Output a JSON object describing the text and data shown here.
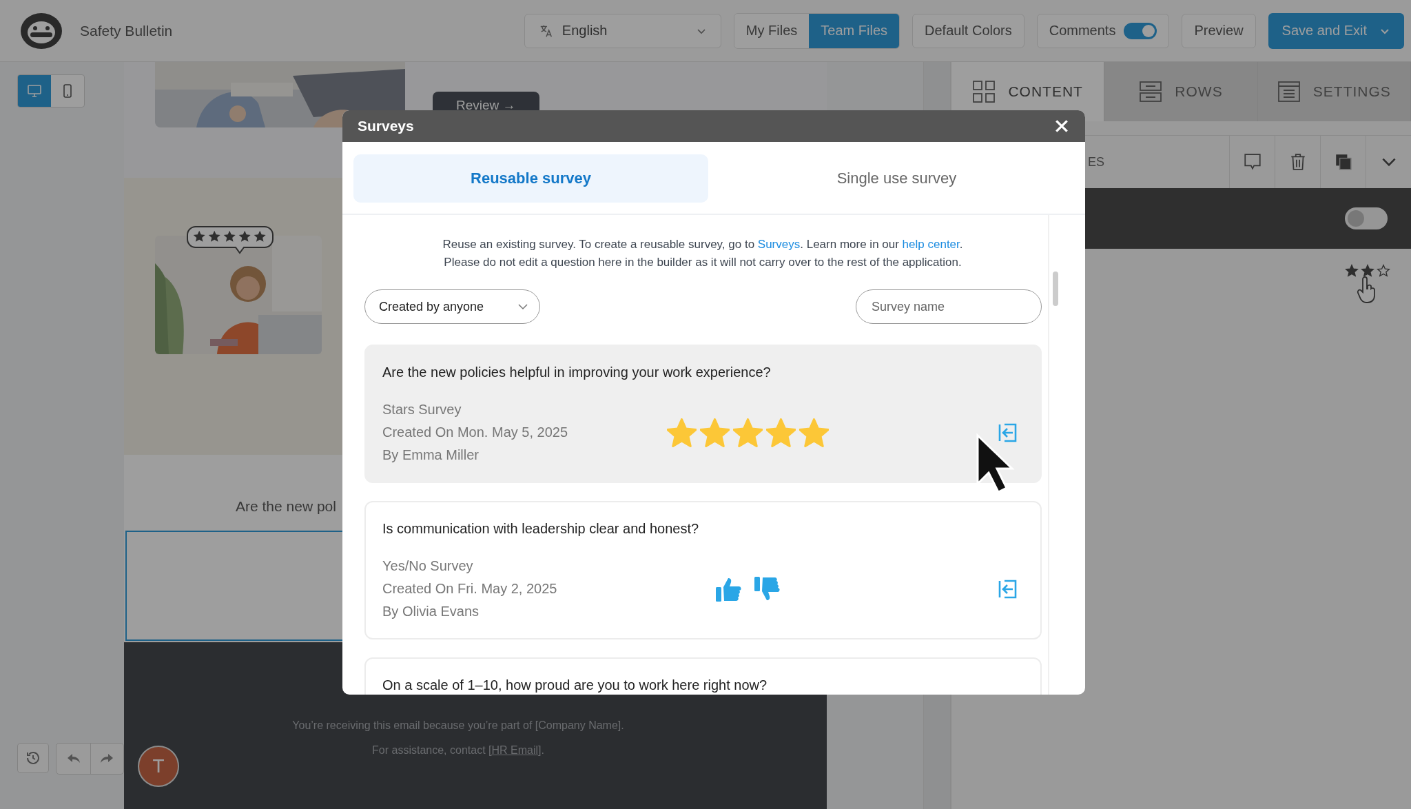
{
  "app": {
    "title": "Safety Bulletin"
  },
  "toolbar": {
    "language": "English",
    "file_tabs": [
      {
        "label": "My Files",
        "selected": false
      },
      {
        "label": "Team Files",
        "selected": true
      }
    ],
    "default_colors": "Default Colors",
    "comments": {
      "label": "Comments",
      "on": true
    },
    "preview": "Preview",
    "save": "Save and Exit"
  },
  "device_toggle": [
    {
      "kind": "desktop",
      "selected": true
    },
    {
      "kind": "mobile",
      "selected": false
    }
  ],
  "canvas": {
    "review_button": "Review →",
    "question_preview": "Are the new pol",
    "notice": "You’re receiving this email because you’re part of [Company Name].",
    "contact_prefix": "For assistance, contact ",
    "contact_link": "[HR Email]",
    "contact_suffix": "."
  },
  "history": {
    "avatar": "T"
  },
  "panel": {
    "tabs": [
      {
        "label": "CONTENT",
        "kind": "grid",
        "selected": true
      },
      {
        "label": "ROWS",
        "kind": "rows",
        "selected": false
      },
      {
        "label": "SETTINGS",
        "kind": "settings",
        "selected": false
      }
    ],
    "section_label": "ES",
    "toggle_on": false,
    "stars": 2
  },
  "modal": {
    "title": "Surveys",
    "tabs": [
      {
        "label": "Reusable survey",
        "selected": true
      },
      {
        "label": "Single use survey",
        "selected": false
      }
    ],
    "intro_prefix": "Reuse an existing survey. To create a reusable survey, go to ",
    "intro_link_1": "Surveys",
    "intro_middle": ". Learn more in our ",
    "intro_link_2": "help center",
    "intro_suffix": ".",
    "note": "Please do not edit a question here in the builder as it will not carry over to the rest of the application.",
    "filter": "Created by anyone",
    "search": {
      "placeholder": "Survey name"
    },
    "surveys": [
      {
        "question": "Are the new policies helpful in improving your work experience?",
        "type": "Stars Survey",
        "kind": "stars",
        "stars": 5,
        "created": "Created On Mon. May 5, 2025",
        "author": "By Emma Miller",
        "selected": true
      },
      {
        "question": "Is communication with leadership clear and honest?",
        "type": "Yes/No Survey",
        "kind": "yes_no",
        "created": "Created On Fri. May 2, 2025",
        "author": "By Olivia Evans",
        "selected": false
      },
      {
        "question": "On a scale of 1–10, how proud are you to work here right now?",
        "selected": false
      }
    ]
  }
}
